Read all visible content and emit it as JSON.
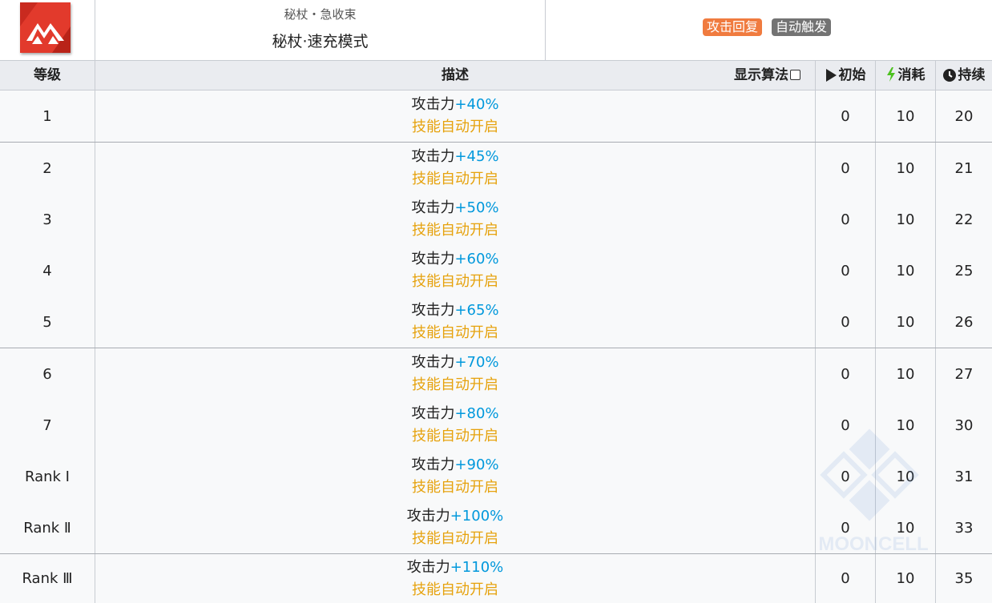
{
  "skill": {
    "subname": "秘杖・急收束",
    "name": "秘杖·速充模式",
    "tags": [
      {
        "label": "攻击回复",
        "color": "#f07b3f"
      },
      {
        "label": "自动触发",
        "color": "#737373"
      }
    ],
    "icon": "skill-emblem-icon",
    "accent": "#e23a2c"
  },
  "table": {
    "headers": {
      "level": "等级",
      "desc": "描述",
      "show_algo": "显示算法",
      "start": "初始",
      "cost": "消耗",
      "duration": "持续"
    },
    "rows": [
      {
        "level": "1",
        "attr": "攻击力",
        "value": "+40%",
        "note": "技能自动开启",
        "start": "0",
        "cost": "10",
        "duration": "20"
      },
      {
        "level": "2",
        "attr": "攻击力",
        "value": "+45%",
        "note": "技能自动开启",
        "start": "0",
        "cost": "10",
        "duration": "21"
      },
      {
        "level": "3",
        "attr": "攻击力",
        "value": "+50%",
        "note": "技能自动开启",
        "start": "0",
        "cost": "10",
        "duration": "22"
      },
      {
        "level": "4",
        "attr": "攻击力",
        "value": "+60%",
        "note": "技能自动开启",
        "start": "0",
        "cost": "10",
        "duration": "25"
      },
      {
        "level": "5",
        "attr": "攻击力",
        "value": "+65%",
        "note": "技能自动开启",
        "start": "0",
        "cost": "10",
        "duration": "26"
      },
      {
        "level": "6",
        "attr": "攻击力",
        "value": "+70%",
        "note": "技能自动开启",
        "start": "0",
        "cost": "10",
        "duration": "27"
      },
      {
        "level": "7",
        "attr": "攻击力",
        "value": "+80%",
        "note": "技能自动开启",
        "start": "0",
        "cost": "10",
        "duration": "30"
      },
      {
        "level": "Rank Ⅰ",
        "attr": "攻击力",
        "value": "+90%",
        "note": "技能自动开启",
        "start": "0",
        "cost": "10",
        "duration": "31"
      },
      {
        "level": "Rank Ⅱ",
        "attr": "攻击力",
        "value": "+100%",
        "note": "技能自动开启",
        "start": "0",
        "cost": "10",
        "duration": "33"
      },
      {
        "level": "Rank Ⅲ",
        "attr": "攻击力",
        "value": "+110%",
        "note": "技能自动开启",
        "start": "0",
        "cost": "10",
        "duration": "35"
      }
    ]
  },
  "colors": {
    "value_blue": "#0098dc",
    "note_orange": "#e6a20d",
    "header_bg": "#eaecf0",
    "cost_green": "#4cc11f"
  },
  "watermark": "MOONCELL"
}
